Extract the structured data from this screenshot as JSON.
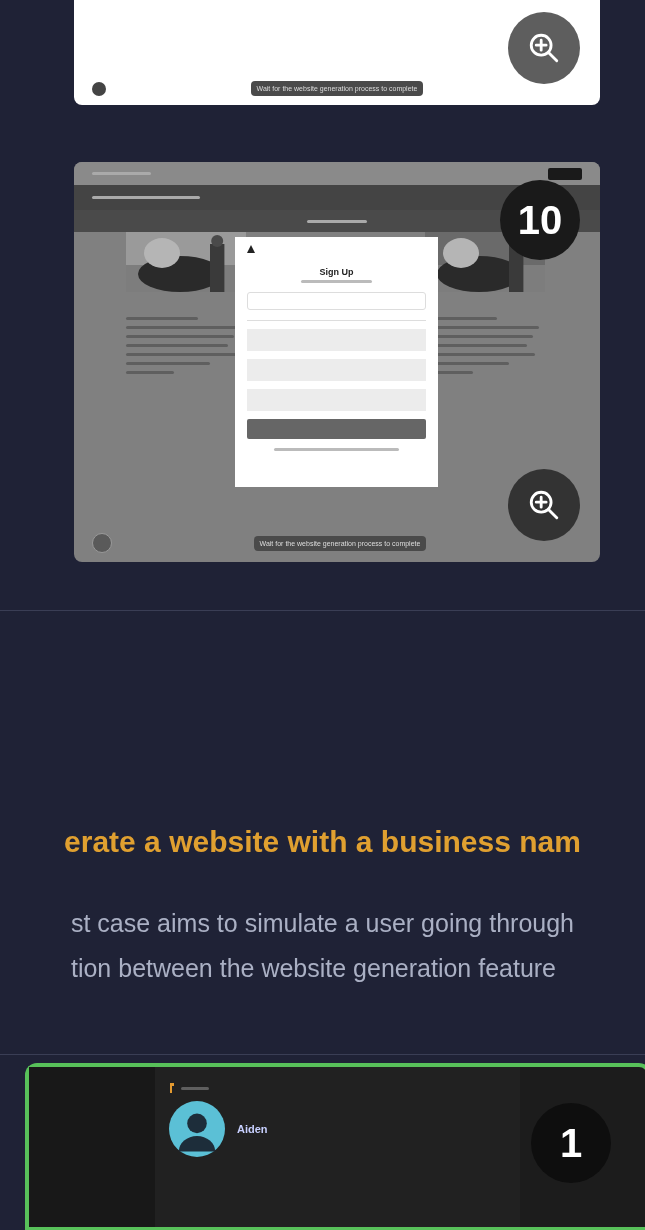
{
  "cards": [
    {
      "kind": "blank",
      "tooltip": "Wait for the website generation process to complete"
    },
    {
      "kind": "signup",
      "badge": "10",
      "modal_title": "Sign Up",
      "tooltip": "Wait for the website generation process to complete"
    }
  ],
  "section": {
    "title": "erate a website with a business nam",
    "description_lines": [
      "st case aims to simulate a user going through",
      "tion between the website generation feature"
    ]
  },
  "preview": {
    "badge": "1",
    "user_name": "Aiden"
  }
}
